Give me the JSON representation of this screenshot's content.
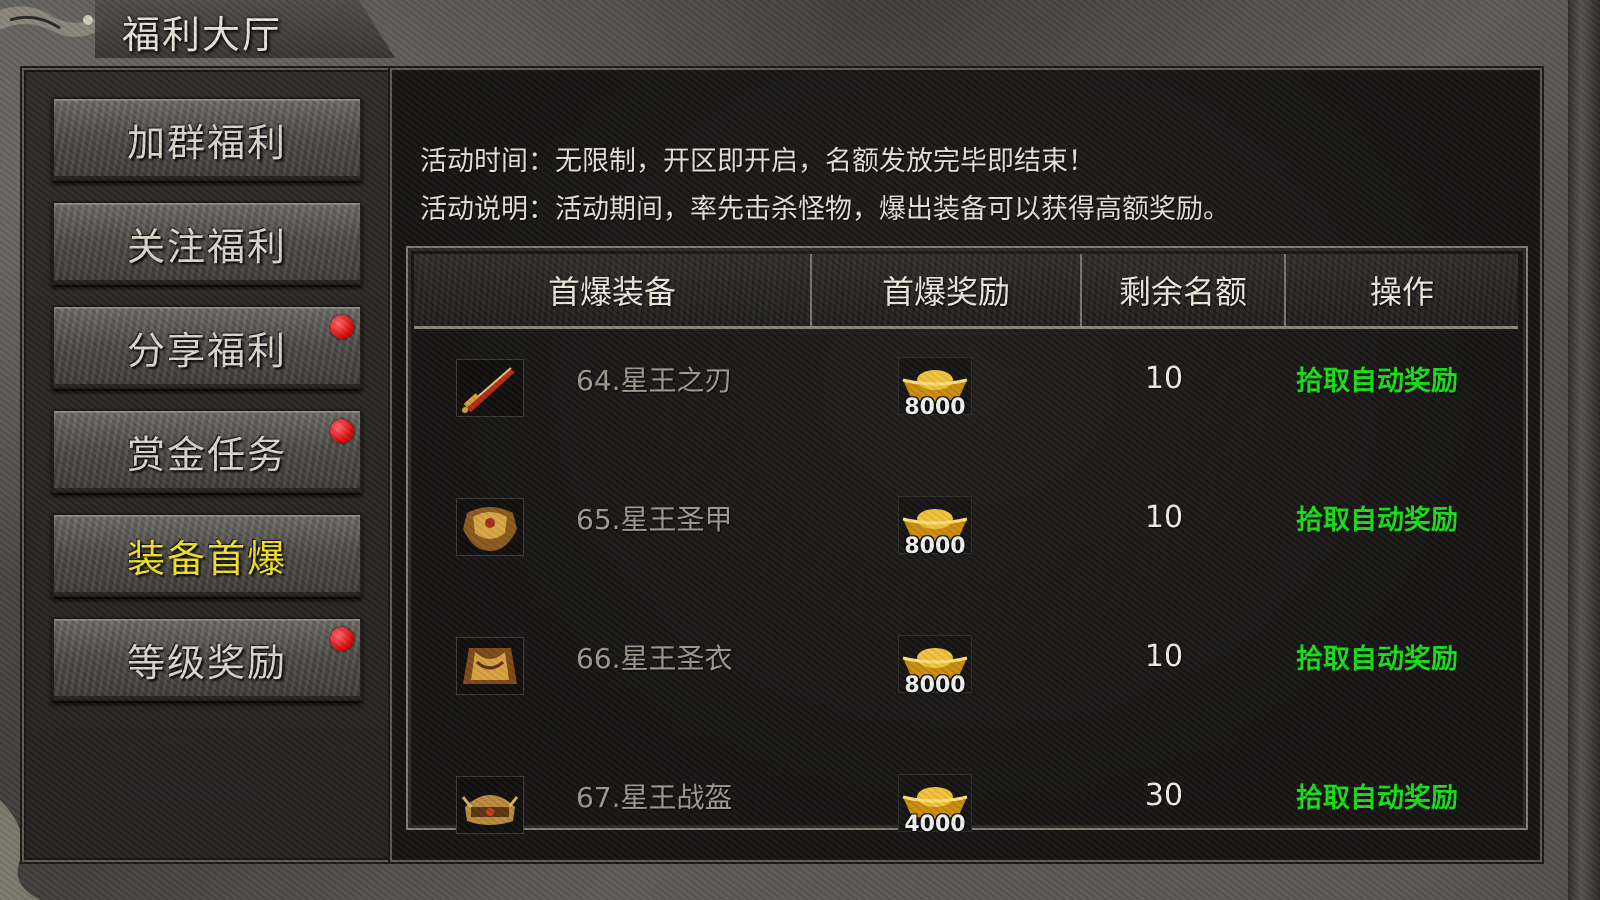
{
  "window": {
    "title": "福利大厅"
  },
  "sidebar": {
    "items": [
      {
        "label": "加群福利",
        "badge": false,
        "active": false
      },
      {
        "label": "关注福利",
        "badge": false,
        "active": false
      },
      {
        "label": "分享福利",
        "badge": true,
        "active": false
      },
      {
        "label": "赏金任务",
        "badge": true,
        "active": false
      },
      {
        "label": "装备首爆",
        "badge": false,
        "active": true
      },
      {
        "label": "等级奖励",
        "badge": true,
        "active": false
      }
    ]
  },
  "info": {
    "time": "活动时间：无限制，开区即开启，名额发放完毕即结束！",
    "desc": "活动说明：活动期间，率先击杀怪物，爆出装备可以获得高额奖励。"
  },
  "table": {
    "headers": [
      "首爆装备",
      "首爆奖励",
      "剩余名额",
      "操作"
    ],
    "rows": [
      {
        "item": "64.星王之刃",
        "icon": "sword-icon",
        "reward": "8000",
        "remaining": "10",
        "action": "拾取自动奖励"
      },
      {
        "item": "65.星王圣甲",
        "icon": "armor-icon",
        "reward": "8000",
        "remaining": "10",
        "action": "拾取自动奖励"
      },
      {
        "item": "66.星王圣衣",
        "icon": "robe-icon",
        "reward": "8000",
        "remaining": "10",
        "action": "拾取自动奖励"
      },
      {
        "item": "67.星王战盔",
        "icon": "helmet-icon",
        "reward": "4000",
        "remaining": "30",
        "action": "拾取自动奖励"
      }
    ]
  },
  "colors": {
    "active_label": "#f3e224",
    "action_text": "#16e016",
    "badge": "#d80c0c",
    "gold": "#f2b814"
  }
}
